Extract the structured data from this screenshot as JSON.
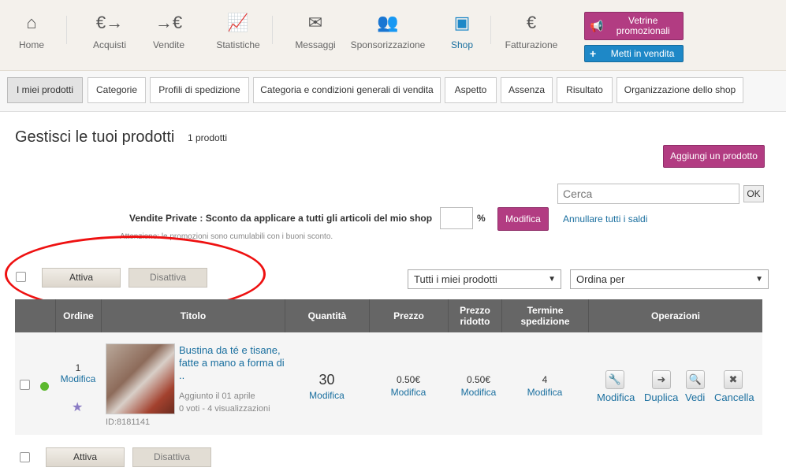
{
  "nav": [
    {
      "label": "Home",
      "icon": "home-icon",
      "glyph": "⌂"
    },
    {
      "label": "Acquisti",
      "icon": "euro-in-icon",
      "glyph": "€→"
    },
    {
      "label": "Vendite",
      "icon": "euro-out-icon",
      "glyph": "→€"
    },
    {
      "label": "Statistiche",
      "icon": "chart-icon",
      "glyph": "📈"
    },
    {
      "label": "Messaggi",
      "icon": "messages-icon",
      "glyph": "✉"
    },
    {
      "label": "Sponsorizzazione",
      "icon": "sponsor-icon",
      "glyph": "👥"
    },
    {
      "label": "Shop",
      "icon": "shop-icon",
      "glyph": "▣"
    },
    {
      "label": "Fatturazione",
      "icon": "invoice-icon",
      "glyph": "€"
    }
  ],
  "promo_button": "Vetrine promozionali",
  "sell_button": "Metti in vendita",
  "tabs": [
    "I miei prodotti",
    "Categorie",
    "Profili di spedizione",
    "Categoria e condizioni generali di vendita",
    "Aspetto",
    "Assenza",
    "Risultato",
    "Organizzazione dello shop"
  ],
  "page_title": "Gestisci le tuoi prodotti",
  "product_count": "1 prodotti",
  "add_product": "Aggiungi un prodotto",
  "search": {
    "placeholder": "Cerca",
    "ok": "OK"
  },
  "private_sales": {
    "label": "Vendite Private : Sconto da applicare a tutti gli articoli del mio shop",
    "unit": "%",
    "apply": "Modifica",
    "cancel_all": "Annullare tutti i saldi",
    "note": "Attenzione: le promozioni sono cumulabili con i buoni sconto."
  },
  "bulk": {
    "activate": "Attiva",
    "deactivate": "Disattiva"
  },
  "filter": {
    "selected": "Tutti i miei prodotti"
  },
  "sort": {
    "selected": "Ordina per"
  },
  "columns": [
    "Ordine",
    "Titolo",
    "Quantità",
    "Prezzo",
    "Prezzo ridotto",
    "Termine spedizione",
    "Operazioni"
  ],
  "product": {
    "order": "1",
    "edit": "Modifica",
    "title": "Bustina da té e tisane, fatte a mano a forma di ..",
    "added": "Aggiunto il 01 aprile",
    "stats": "0 voti - 4 visualizzazioni",
    "id": "ID:8181141",
    "quantity": "30",
    "price": "0.50€",
    "reduced_price": "0.50€",
    "shipping_term": "4",
    "ops": [
      "Modifica",
      "Duplica",
      "Vedi",
      "Cancella"
    ]
  },
  "colors": {
    "purple": "#b23c82",
    "blue": "#1e88c7",
    "link": "#1a6f9f",
    "header": "#666666"
  }
}
